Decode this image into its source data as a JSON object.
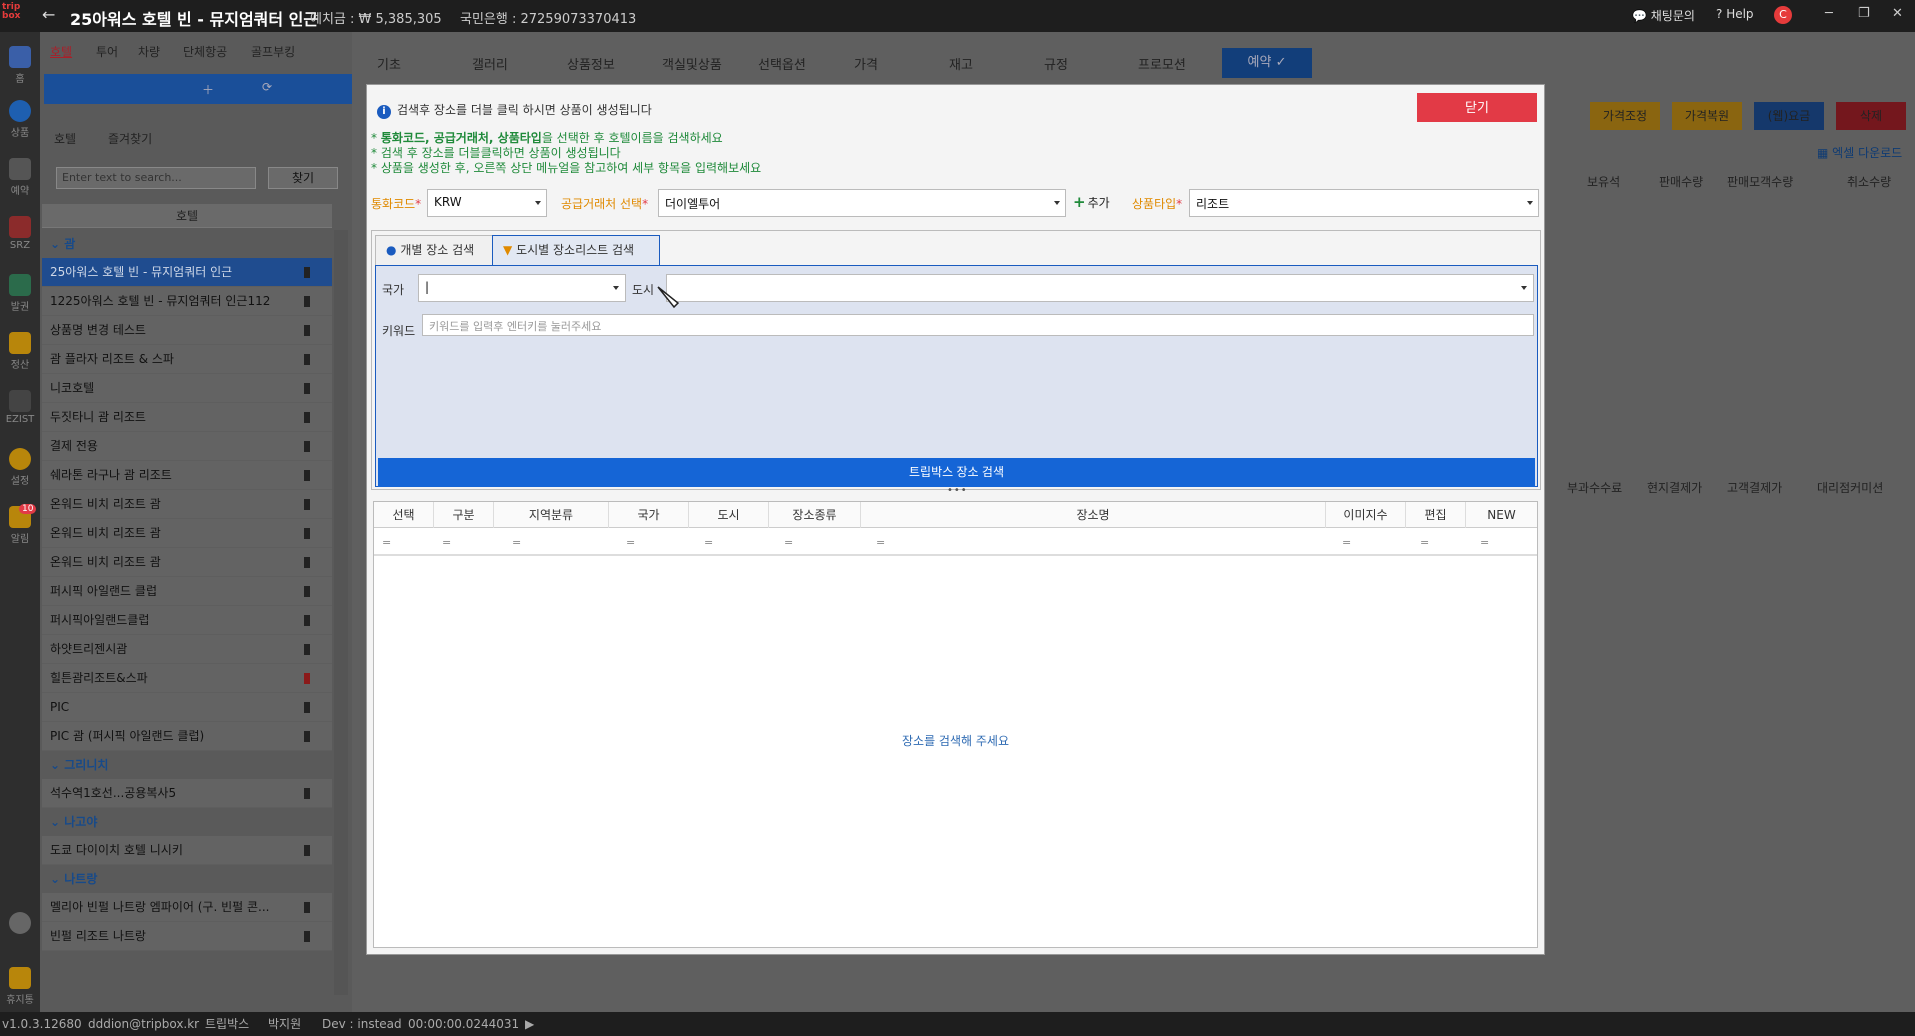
{
  "titlebar": {
    "logo_text": "trip box",
    "title": "25아워스 호텔 빈 - 뮤지엄쿼터 인근",
    "deposit": "예치금 : ₩ 5,385,305",
    "bank": "국민은행 : 27259073370413",
    "chat": "채팅문의",
    "help": "Help",
    "user_initial": "C"
  },
  "leftbar": {
    "items": [
      {
        "label": "홈"
      },
      {
        "label": "상품"
      },
      {
        "label": "예약"
      },
      {
        "label": "SRZ"
      },
      {
        "label": "발권"
      },
      {
        "label": "정산"
      },
      {
        "label": "EZIST"
      },
      {
        "label": "설정"
      },
      {
        "label": "알림",
        "badge": "10"
      },
      {
        "label": "휴지통"
      }
    ]
  },
  "panel": {
    "top_tabs": [
      "호텔",
      "투어",
      "차량",
      "단체항공",
      "골프부킹"
    ],
    "sub_tabs": [
      "호텔",
      "즐겨찾기"
    ],
    "search_placeholder": "Enter text to search...",
    "find_label": "찾기",
    "column_header": "호텔",
    "groups": [
      {
        "name": "괌",
        "items": [
          {
            "name": "25아워스 호텔 빈 - 뮤지엄쿼터 인근",
            "selected": true
          },
          {
            "name": "1225아워스 호텔 빈 - 뮤지엄쿼터 인근112"
          },
          {
            "name": "상품명 변경 테스트"
          },
          {
            "name": "괌 플라자 리조트 & 스파"
          },
          {
            "name": "니코호텔"
          },
          {
            "name": "두짓타니 괌 리조트"
          },
          {
            "name": "결제 전용"
          },
          {
            "name": "쉐라톤 라구나 괌 리조트"
          },
          {
            "name": "온워드 비치 리조트 괌"
          },
          {
            "name": "온워드 비치 리조트 괌"
          },
          {
            "name": "온워드 비치 리조트 괌"
          },
          {
            "name": "퍼시픽 아일랜드 클럽"
          },
          {
            "name": "퍼시픽아일랜드클럽"
          },
          {
            "name": "하얏트리젠시괌"
          },
          {
            "name": "힐튼괌리조트&스파",
            "bookmark_red": true
          },
          {
            "name": "PIC"
          },
          {
            "name": "PIC 괌 (퍼시픽 아일랜드 클럽)"
          }
        ]
      },
      {
        "name": "그리니치",
        "items": [
          {
            "name": "석수역1호선...공용복사5"
          }
        ]
      },
      {
        "name": "나고야",
        "items": [
          {
            "name": "도쿄 다이이치 호텔 니시키"
          }
        ]
      },
      {
        "name": "나트랑",
        "items": [
          {
            "name": "멜리아 빈펄 나트랑 엠파이어 (구. 빈펄 콘..."
          },
          {
            "name": "빈펄 리조트 나트랑"
          }
        ]
      }
    ]
  },
  "main": {
    "topnav": [
      "기초",
      "갤러리",
      "상품정보",
      "객실및상품",
      "선택옵션",
      "가격",
      "재고",
      "규정",
      "프로모션"
    ],
    "reservation_tab": "예약",
    "buttons": [
      {
        "label": "가격조정",
        "color": "#c8900e"
      },
      {
        "label": "가격복원",
        "color": "#c8900e"
      },
      {
        "label": "(웹)요금",
        "color": "#1a4f99"
      },
      {
        "label": "삭제",
        "color": "#a8202a"
      }
    ],
    "excel_label": "엑셀 다운로드",
    "grid_top_headers": [
      "보유석",
      "판매수량",
      "판매모객수량",
      "취소수량"
    ],
    "grid_bottom_headers": [
      "부과수수료",
      "현지결제가",
      "고객결제가",
      "대리점커미션"
    ]
  },
  "modal": {
    "info": "검색후 장소를 더블 클릭 하시면 상품이 생성됩니다",
    "close_label": "닫기",
    "note1_bold": "통화코드, 공급거래처, 상품타입",
    "note1_rest": "을 선택한 후 호텔이름을 검색하세요",
    "note2": "* 검색 후 장소를 더블클릭하면 상품이 생성됩니다",
    "note3": "* 상품을 생성한 후, 오른쪽 상단 메뉴얼을 참고하여 세부 항목을 입력해보세요",
    "currency_label": "통화코드",
    "currency_value": "KRW",
    "supplier_label": "공급거래처 선택",
    "supplier_value": "더이엘투어",
    "add_label": "추가",
    "product_type_label": "상품타입",
    "product_type_value": "리조트",
    "tab_individual": "개별 장소 검색",
    "tab_city": "도시별 장소리스트 검색",
    "country_label": "국가",
    "city_label": "도시",
    "keyword_label": "키워드",
    "keyword_placeholder": "키워드를 입력후 엔터키를 눌러주세요",
    "search_button": "트립박스 장소 검색",
    "grid_headers": [
      "선택",
      "구분",
      "지역분류",
      "국가",
      "도시",
      "장소종류",
      "장소명",
      "이미지수",
      "편집",
      "NEW"
    ],
    "empty_message": "장소를 검색해 주세요"
  },
  "statusbar": {
    "version": "v1.0.3.12680",
    "email": "dddion@tripbox.kr",
    "company": "트립박스",
    "user": "박지원",
    "env": "Dev : instead",
    "timer": "00:00:00.0244031"
  }
}
